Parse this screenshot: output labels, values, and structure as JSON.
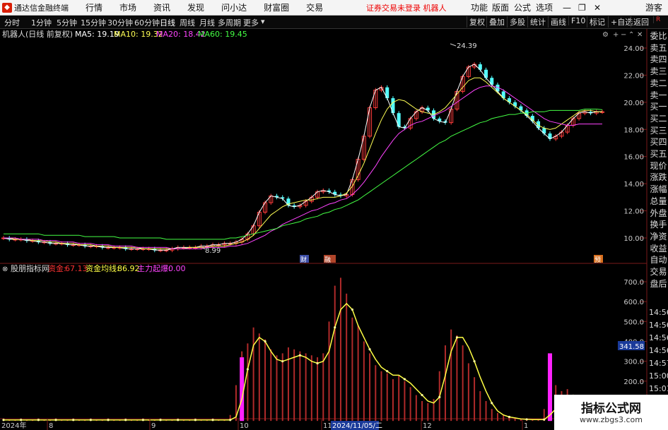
{
  "titlebar": {
    "app_name": "通达信金融终端",
    "menus": [
      "行情",
      "市场",
      "资讯",
      "发现",
      "问小达",
      "财富圈",
      "交易"
    ],
    "warning": "证券交易未登录  机器人",
    "right_menus": [
      "功能",
      "版面",
      "公式",
      "选项"
    ],
    "guest": "游客"
  },
  "toolbar": {
    "periods": [
      "分时",
      "1分钟",
      "5分钟",
      "15分钟",
      "30分钟",
      "60分钟",
      "日线",
      "周线",
      "月线",
      "多周期",
      "更多"
    ],
    "selected": "日线",
    "right_buttons": [
      "复权",
      "叠加",
      "多股",
      "统计",
      "画线",
      "F10",
      "标记",
      "+自选",
      "返回"
    ]
  },
  "upper": {
    "stock_label": "机器人(日线 前复权)",
    "ma": [
      {
        "label": "MA5: 19.19",
        "color": "#ffffff"
      },
      {
        "label": "MA10: 19.32",
        "color": "#ffff55"
      },
      {
        "label": "MA20: 18.42",
        "color": "#ff44ff"
      },
      {
        "label": "MA60: 19.45",
        "color": "#44ff44"
      }
    ],
    "high_label": "24.39",
    "low_label": "8.99",
    "markers": [
      "财",
      "融"
    ],
    "marker_right": "预",
    "y_ticks": [
      "24.00",
      "22.00",
      "20.00",
      "18.00",
      "16.00",
      "14.00",
      "12.00",
      "10.00"
    ]
  },
  "lower": {
    "indicator_name": "股朋指标网",
    "fund": {
      "label": "资金:",
      "value": "67.13",
      "color": "#ff3333"
    },
    "fund_avg": {
      "label": "资金均线:",
      "value": "86.92",
      "color": "#ffff44"
    },
    "main": {
      "label": "主力起爆:",
      "value": "0.00",
      "color": "#ff44ff"
    },
    "y_ticks": [
      "700.0",
      "600.0",
      "500.0",
      "400.0",
      "300.0",
      "200.0",
      "100.0"
    ],
    "cursor_value": "341.58"
  },
  "xaxis": {
    "labels": [
      "2024年",
      "8",
      "9",
      "10",
      "11",
      "2024/11/05/二",
      "12",
      "1"
    ]
  },
  "side_panel": {
    "words": [
      "委比",
      "卖五",
      "卖四",
      "卖三",
      "卖二",
      "卖一",
      "买一",
      "买二",
      "买三",
      "买四",
      "买五",
      "现价",
      "涨跌",
      "涨幅",
      "总量",
      "外盘",
      "换手",
      "净资",
      "收益",
      "自动",
      "交易",
      "盘后"
    ],
    "times": [
      "14:56",
      "14:56",
      "14:56",
      "14:56",
      "14:57",
      "15:00",
      "15:01"
    ]
  },
  "chart_data": [
    {
      "type": "candlestick",
      "title": "机器人(日线 前复权)",
      "ylim": [
        8.5,
        25
      ],
      "series": [
        {
          "name": "MA5",
          "values": [
            10.0,
            9.9,
            9.9,
            9.9,
            9.8,
            9.8,
            9.7,
            9.7,
            9.6,
            9.6,
            9.6,
            9.5,
            9.5,
            9.5,
            9.4,
            9.4,
            9.4,
            9.3,
            9.3,
            9.3,
            9.3,
            9.2,
            9.2,
            9.2,
            9.2,
            9.2,
            9.1,
            9.1,
            9.1,
            9.2,
            9.3,
            9.3,
            9.3,
            9.3,
            9.4,
            9.4,
            9.5,
            9.5,
            9.6,
            9.6,
            9.7,
            9.9,
            10.3,
            10.9,
            11.9,
            12.6,
            13.1,
            13.0,
            12.9,
            12.4,
            12.3,
            12.4,
            12.7,
            13.0,
            13.4,
            13.5,
            13.4,
            13.2,
            13.1,
            13.2,
            14.3,
            15.8,
            17.5,
            19.6,
            20.9,
            21.1,
            20.3,
            19.2,
            18.2,
            18.1,
            18.8,
            19.3,
            19.6,
            19.4,
            18.8,
            18.6,
            18.5,
            19.5,
            20.8,
            21.9,
            22.6,
            22.8,
            22.4,
            21.8,
            21.3,
            20.8,
            20.3,
            20.0,
            19.7,
            19.4,
            19.0,
            18.6,
            18.1,
            17.7,
            17.3,
            17.5,
            17.8,
            18.3,
            18.8,
            19.2,
            19.3,
            19.2,
            19.3,
            19.3
          ]
        },
        {
          "name": "MA10",
          "values": [
            10.0,
            10.0,
            9.9,
            9.9,
            9.9,
            9.8,
            9.8,
            9.8,
            9.7,
            9.7,
            9.6,
            9.6,
            9.6,
            9.5,
            9.5,
            9.5,
            9.4,
            9.4,
            9.4,
            9.3,
            9.3,
            9.3,
            9.3,
            9.3,
            9.2,
            9.2,
            9.2,
            9.2,
            9.2,
            9.2,
            9.2,
            9.2,
            9.3,
            9.3,
            9.3,
            9.3,
            9.4,
            9.4,
            9.4,
            9.5,
            9.6,
            9.7,
            9.9,
            10.2,
            10.7,
            11.2,
            11.7,
            12.0,
            12.3,
            12.5,
            12.6,
            12.7,
            12.8,
            12.8,
            12.9,
            13.0,
            13.0,
            13.0,
            13.1,
            13.3,
            13.8,
            14.6,
            15.5,
            16.6,
            17.7,
            18.7,
            19.5,
            20.0,
            20.2,
            20.1,
            19.8,
            19.5,
            19.3,
            19.2,
            19.1,
            19.3,
            19.6,
            20.1,
            20.6,
            21.1,
            21.6,
            21.8,
            21.8,
            21.5,
            21.1,
            20.7,
            20.3,
            20.0,
            19.7,
            19.4,
            19.1,
            18.7,
            18.3,
            18.1,
            18.0,
            18.1,
            18.4,
            18.7,
            19.0,
            19.3,
            19.4,
            19.4,
            19.3,
            19.3
          ]
        },
        {
          "name": "MA20",
          "values": [
            10.0,
            10.0,
            10.0,
            9.9,
            9.9,
            9.9,
            9.9,
            9.8,
            9.8,
            9.8,
            9.7,
            9.7,
            9.7,
            9.6,
            9.6,
            9.6,
            9.5,
            9.5,
            9.5,
            9.4,
            9.4,
            9.4,
            9.4,
            9.3,
            9.3,
            9.3,
            9.3,
            9.3,
            9.3,
            9.2,
            9.2,
            9.2,
            9.2,
            9.2,
            9.2,
            9.3,
            9.3,
            9.3,
            9.3,
            9.4,
            9.4,
            9.5,
            9.6,
            9.8,
            10.0,
            10.2,
            10.5,
            10.7,
            11.0,
            11.2,
            11.4,
            11.6,
            11.8,
            12.0,
            12.1,
            12.3,
            12.5,
            12.6,
            12.8,
            12.9,
            13.2,
            13.6,
            14.1,
            14.7,
            15.3,
            16.0,
            16.6,
            17.2,
            17.7,
            18.0,
            18.3,
            18.5,
            18.6,
            18.8,
            19.0,
            19.2,
            19.4,
            19.7,
            20.0,
            20.3,
            20.6,
            20.9,
            21.1,
            21.2,
            21.2,
            21.1,
            20.9,
            20.6,
            20.3,
            20.0,
            19.7,
            19.4,
            19.1,
            18.8,
            18.6,
            18.5,
            18.4,
            18.3,
            18.3,
            18.4,
            18.4,
            18.4,
            18.4,
            18.4
          ]
        },
        {
          "name": "MA60",
          "values": [
            10.3,
            10.3,
            10.3,
            10.3,
            10.3,
            10.3,
            10.3,
            10.2,
            10.2,
            10.2,
            10.2,
            10.2,
            10.2,
            10.2,
            10.1,
            10.1,
            10.1,
            10.1,
            10.1,
            10.1,
            10.0,
            10.0,
            10.0,
            10.0,
            10.0,
            10.0,
            10.0,
            10.0,
            9.9,
            9.9,
            9.9,
            9.9,
            9.9,
            9.9,
            9.9,
            9.9,
            9.9,
            9.9,
            9.9,
            10.0,
            10.0,
            10.1,
            10.2,
            10.3,
            10.4,
            10.5,
            10.6,
            10.7,
            10.9,
            11.0,
            11.1,
            11.2,
            11.4,
            11.5,
            11.6,
            11.8,
            11.9,
            12.1,
            12.2,
            12.4,
            12.6,
            12.8,
            13.1,
            13.4,
            13.7,
            14.0,
            14.3,
            14.6,
            14.9,
            15.2,
            15.5,
            15.8,
            16.1,
            16.4,
            16.7,
            17.0,
            17.2,
            17.5,
            17.7,
            17.9,
            18.1,
            18.3,
            18.5,
            18.6,
            18.8,
            18.9,
            19.0,
            19.1,
            19.1,
            19.2,
            19.2,
            19.3,
            19.3,
            19.3,
            19.4,
            19.4,
            19.4,
            19.4,
            19.4,
            19.4,
            19.5,
            19.5,
            19.5,
            19.45
          ]
        }
      ]
    },
    {
      "type": "bar",
      "title": "股朋指标网",
      "ylim": [
        0,
        750
      ],
      "series": [
        {
          "name": "资金均线",
          "values": [
            5,
            5,
            5,
            5,
            5,
            5,
            5,
            5,
            5,
            5,
            5,
            5,
            5,
            5,
            5,
            5,
            5,
            5,
            5,
            5,
            5,
            5,
            5,
            5,
            5,
            5,
            5,
            5,
            5,
            5,
            5,
            5,
            5,
            5,
            5,
            5,
            5,
            5,
            5,
            5,
            20,
            110,
            260,
            380,
            420,
            400,
            350,
            310,
            300,
            310,
            320,
            330,
            320,
            300,
            290,
            300,
            350,
            470,
            560,
            590,
            560,
            480,
            420,
            360,
            310,
            270,
            250,
            230,
            230,
            210,
            190,
            160,
            130,
            100,
            90,
            120,
            230,
            350,
            420,
            420,
            370,
            300,
            220,
            150,
            90,
            50,
            30,
            20,
            15,
            10,
            8,
            7,
            7,
            7,
            30,
            60,
            100,
            120,
            130,
            120,
            100,
            90,
            85,
            80
          ]
        },
        {
          "name": "资金",
          "values": [
            5,
            5,
            5,
            5,
            5,
            5,
            5,
            5,
            5,
            5,
            5,
            5,
            5,
            5,
            5,
            5,
            5,
            5,
            5,
            5,
            5,
            5,
            5,
            5,
            5,
            5,
            5,
            5,
            5,
            5,
            5,
            5,
            5,
            5,
            5,
            5,
            5,
            5,
            5,
            30,
            180,
            350,
            390,
            470,
            440,
            410,
            360,
            330,
            340,
            370,
            360,
            350,
            340,
            330,
            320,
            340,
            500,
            680,
            720,
            640,
            520,
            480,
            400,
            340,
            280,
            250,
            240,
            210,
            230,
            200,
            170,
            130,
            100,
            90,
            110,
            250,
            380,
            460,
            430,
            380,
            290,
            220,
            150,
            100,
            60,
            40,
            30,
            20,
            15,
            10,
            8,
            8,
            8,
            60,
            140,
            180,
            150,
            160,
            130,
            110,
            100,
            90,
            85,
            80
          ]
        },
        {
          "name": "主力起爆",
          "values": [
            0,
            0,
            0,
            0,
            0,
            0,
            0,
            0,
            0,
            0,
            0,
            0,
            0,
            0,
            0,
            0,
            0,
            0,
            0,
            0,
            0,
            0,
            0,
            0,
            0,
            0,
            0,
            0,
            0,
            0,
            0,
            0,
            0,
            0,
            0,
            0,
            0,
            0,
            0,
            0,
            0,
            320,
            0,
            0,
            0,
            0,
            0,
            0,
            0,
            0,
            0,
            0,
            0,
            0,
            0,
            0,
            0,
            0,
            0,
            0,
            0,
            0,
            0,
            0,
            0,
            0,
            0,
            0,
            0,
            0,
            0,
            0,
            0,
            0,
            0,
            0,
            0,
            0,
            0,
            0,
            0,
            0,
            0,
            0,
            0,
            0,
            0,
            0,
            0,
            0,
            0,
            0,
            0,
            0,
            340,
            0,
            0,
            0,
            0,
            0,
            0,
            0,
            0,
            0
          ]
        }
      ]
    }
  ]
}
